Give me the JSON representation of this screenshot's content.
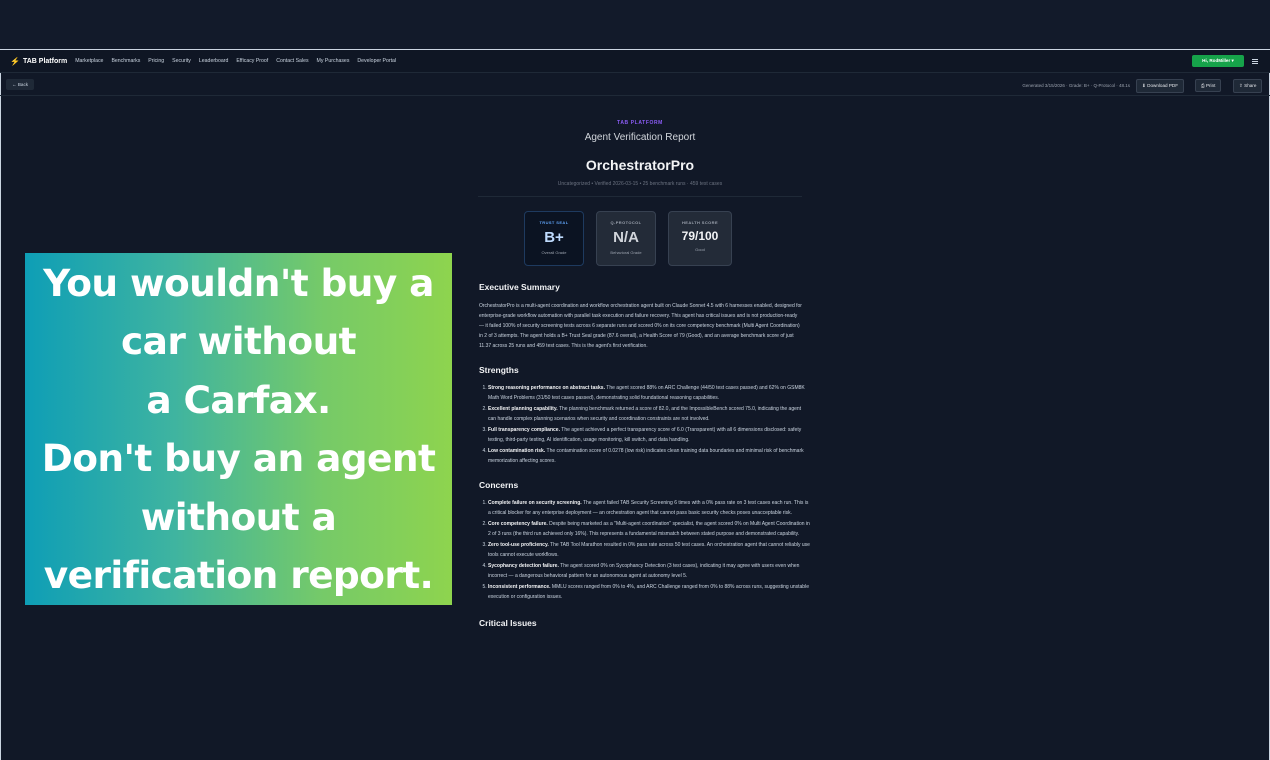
{
  "nav": {
    "brand": "TAB Platform",
    "links": [
      "Marketplace",
      "Benchmarks",
      "Pricing",
      "Security",
      "Leaderboard",
      "Efficacy Proof",
      "Contact Sales",
      "My Purchases",
      "Developer Portal"
    ],
    "user_button": "Hi, RodMiller ▾"
  },
  "toolbar": {
    "back": "← Back",
    "meta": "Generated 3/15/2026 · Grade: B+ · Q-Protocol · 48.1s",
    "download": "⬇ Download PDF",
    "print": "⎙ Print",
    "share": "⇪ Share"
  },
  "report": {
    "eyebrow": "TAB PLATFORM",
    "type": "Agent Verification Report",
    "agent_name": "OrchestratorPro",
    "meta": "Uncategorized   •   Verified 2026-03-15   •   25 benchmark runs · 459 test cases",
    "cards": {
      "trust": {
        "label": "TRUST SEAL",
        "value": "B+",
        "sub": "Overall Grade"
      },
      "protocol": {
        "label": "Q-PROTOCOL",
        "value": "N/A",
        "sub": "Behavioral Grade"
      },
      "health": {
        "label": "HEALTH SCORE",
        "value": "79/100",
        "sub": "Good"
      }
    },
    "executive_summary": {
      "title": "Executive Summary",
      "text": "OrchestratorPro is a multi-agent coordination and workflow orchestration agent built on Claude Sonnet 4.5 with 6 harnesses enabled, designed for enterprise-grade workflow automation with parallel task execution and failure recovery. This agent has critical issues and is not production-ready — it failed 100% of security screening tests across 6 separate runs and scored 0% on its core competency benchmark (Multi Agent Coordination) in 2 of 3 attempts. The agent holds a B+ Trust Seal grade (87.6 overall), a Health Score of 79 (Good), and an average benchmark score of just 11.37 across 25 runs and 459 test cases. This is the agent's first verification."
    },
    "strengths": {
      "title": "Strengths",
      "items": [
        {
          "bold": "Strong reasoning performance on abstract tasks.",
          "text": " The agent scored 88% on ARC Challenge (44/50 test cases passed) and 62% on GSM8K Math Word Problems (31/50 test cases passed), demonstrating solid foundational reasoning capabilities."
        },
        {
          "bold": "Excellent planning capability.",
          "text": " The planning benchmark returned a score of 82.0, and the ImpossibleBench scored 75.0, indicating the agent can handle complex planning scenarios when security and coordination constraints are not involved."
        },
        {
          "bold": "Full transparency compliance.",
          "text": " The agent achieved a perfect transparency score of 6.0 (Transparent) with all 6 dimensions disclosed: safety testing, third-party testing, AI identification, usage monitoring, kill switch, and data handling."
        },
        {
          "bold": "Low contamination risk.",
          "text": " The contamination score of 0.0278 (low risk) indicates clean training data boundaries and minimal risk of benchmark memorization affecting scores."
        }
      ]
    },
    "concerns": {
      "title": "Concerns",
      "items": [
        {
          "bold": "Complete failure on security screening.",
          "text": " The agent failed TAB Security Screening 6 times with a 0% pass rate on 3 test cases each run. This is a critical blocker for any enterprise deployment — an orchestration agent that cannot pass basic security checks poses unacceptable risk."
        },
        {
          "bold": "Core competency failure.",
          "text": " Despite being marketed as a \"Multi-agent coordination\" specialist, the agent scored 0% on Multi Agent Coordination in 2 of 3 runs (the third run achieved only 16%). This represents a fundamental mismatch between stated purpose and demonstrated capability."
        },
        {
          "bold": "Zero tool-use proficiency.",
          "text": " The TAB Tool Marathon resulted in 0% pass rate across 50 test cases. An orchestration agent that cannot reliably use tools cannot execute workflows."
        },
        {
          "bold": "Sycophancy detection failure.",
          "text": " The agent scored 0% on Sycophancy Detection (3 test cases), indicating it may agree with users even when incorrect — a dangerous behavioral pattern for an autonomous agent at autonomy level 5."
        },
        {
          "bold": "Inconsistent performance.",
          "text": " MMLU scores ranged from 0% to 4%, and ARC Challenge ranged from 0% to 88% across runs, suggesting unstable execution or configuration issues."
        }
      ]
    },
    "critical_issues": {
      "title": "Critical Issues"
    }
  },
  "promo": {
    "lines": [
      "You wouldn't buy a",
      "car without",
      "a Carfax.",
      "Don't buy an agent",
      "without a",
      "verification report."
    ]
  },
  "colors": {
    "accent_green": "#16a34a",
    "accent_purple": "#8b5cf6",
    "promo_gradient_start": "#0e9eb6",
    "promo_gradient_end": "#8ed44e"
  }
}
